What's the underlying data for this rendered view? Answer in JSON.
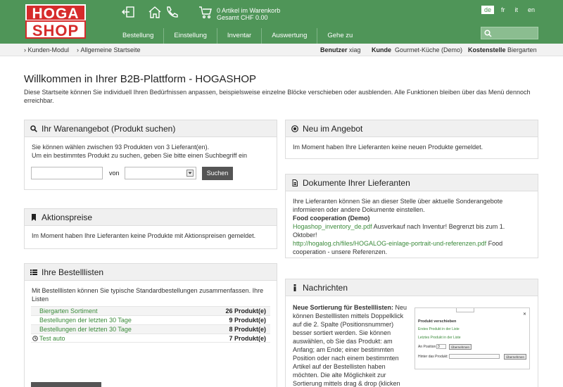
{
  "header": {
    "logo_top": "HOGA",
    "logo_bottom": "SHOP",
    "cart_line1": "0 Artikel im Warenkorb",
    "cart_line2": "Gesamt CHF 0.00",
    "languages": [
      "de",
      "fr",
      "it",
      "en"
    ],
    "active_language": "de",
    "nav": [
      "Bestellung",
      "Einstellung",
      "Inventar",
      "Auswertung",
      "Gehe zu"
    ],
    "icons": [
      "logout-icon",
      "home-icon",
      "phone-icon",
      "cart-icon",
      "search-icon"
    ]
  },
  "breadcrumb": {
    "items": [
      "Kunden-Modul",
      "Allgemeine Startseite"
    ],
    "user_label": "Benutzer",
    "user_value": "xiag",
    "customer_label": "Kunde",
    "customer_value": "Gourmet-Küche (Demo)",
    "cost_label": "Kostenstelle",
    "cost_value": "Biergarten"
  },
  "welcome": {
    "title": "Willkommen in Ihrer B2B-Plattform - HOGASHOP",
    "text": "Diese Startseite können Sie individuell Ihren Bedürfnissen anpassen, beispielsweise einzelne Blöcke verschieben oder ausblenden. Alle Funktionen bleiben über das Menü dennoch erreichbar."
  },
  "warenangebot": {
    "title": "Ihr Warenangebot (Produkt suchen)",
    "line1": "Sie können wählen zwischen 93 Produkten von 3 Lieferant(en).",
    "line2": "Um ein bestimmtes Produkt zu suchen, geben Sie bitte einen Suchbegriff ein",
    "von_label": "von",
    "search_value": "",
    "supplier_value": "",
    "search_button": "Suchen"
  },
  "aktionspreise": {
    "title": "Aktionspreise",
    "text": "Im Moment haben Ihre Lieferanten keine Produkte mit Aktionspreisen gemeldet."
  },
  "bestelllisten": {
    "title": "Ihre Bestelllisten",
    "text": "Mit Bestelllisten können Sie typische Standardbestellungen zusammenfassen. Ihre Listen",
    "rows": [
      {
        "name": "Biergarten Sortiment",
        "count": "26 Produkt(e)"
      },
      {
        "name": "Bestellungen der letzten 30 Tage",
        "count": "9 Produkt(e)"
      },
      {
        "name": "Bestellungen der letzten 30 Tage",
        "count": "8 Produkt(e)"
      },
      {
        "name": "Test auto",
        "count": "7 Produkt(e)"
      }
    ]
  },
  "neu": {
    "title": "Neu im Angebot",
    "text": "Im Moment haben Ihre Lieferanten keine neuen Produkte gemeldet."
  },
  "dokumente": {
    "title": "Dokumente Ihrer Lieferanten",
    "text": "Ihre Lieferanten können Sie an dieser Stelle über aktuelle Sonderangebote informieren oder andere Dokumente einstellen.",
    "supplier": "Food cooperation (Demo)",
    "link1": "Hogashop_inventory_de.pdf",
    "link1_desc": "Ausverkauf nach Inventur! Begrenzt bis zum 1. Oktober!",
    "link2": "http://hogalog.ch/files/HOGALOG-einlage-portrait-und-referenzen.pdf",
    "link2_desc": "Food cooperation - unsere Referenzen."
  },
  "nachrichten": {
    "title": "Nachrichten",
    "headline": "Neue Sortierung für Bestelllisten:",
    "body": "Neu können Bestelllisten mittels Doppelklick auf die 2. Spalte (Positionsnummer) besser sortiert werden. Sie können auswählen, ob Sie das Produkt: am Anfang; am Ende; einer bestimmten Position oder nach einem bestimmten Artikel auf der Bestellisten haben möchten. Die alte Möglichkeit zur Sortierung mittels drag & drop (klicken und ziehen) besteht weiterhin.",
    "thumb": {
      "title": "Produkt verschieben",
      "link1": "Erstes Produkt in der Liste",
      "link2": "Letztes Produkt in der Liste",
      "pos_label": "An Position",
      "pos_value": "3",
      "btn1": "Übernehmen",
      "after_label": "Hinter das Produkt:",
      "btn2": "Übernehmen"
    }
  }
}
